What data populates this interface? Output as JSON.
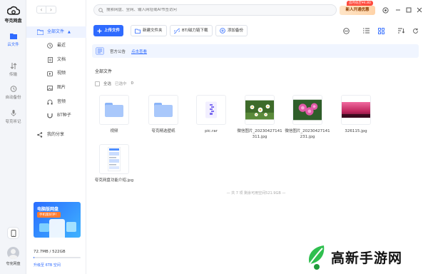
{
  "app": {
    "name": "夸克网盘"
  },
  "rail": {
    "items": [
      {
        "label": "云文件"
      },
      {
        "label": "传输"
      },
      {
        "label": "自动备份"
      },
      {
        "label": "夸克听记"
      }
    ],
    "user_label": "夸克网盘"
  },
  "tree": {
    "all_files": "全部文件",
    "recent": "最近",
    "docs": "文档",
    "video": "视频",
    "image": "图片",
    "audio": "音频",
    "bt": "BT种子",
    "share": "我的分享"
  },
  "promo": {
    "title": "电脑版网盘",
    "tag": "手机版好评！"
  },
  "storage": {
    "text": "72.7MB / 522GB",
    "used_fraction": 0.01,
    "upgrade": "升级至 6TB 空间"
  },
  "search": {
    "placeholder": "搜索网盘、全网、输入网址或AI书签访问"
  },
  "vip": {
    "label": "新人开通优惠",
    "tag": "首月低至¥4.80"
  },
  "toolbar": {
    "upload": "上传文件",
    "new_folder": "新建文件夹",
    "bt_download": "BT/磁力链下载",
    "add_backup": "添加备份"
  },
  "notice": {
    "label": "官方公告",
    "link": "点击查看"
  },
  "crumb": "全部文件",
  "selectall": {
    "label": "全选",
    "selected": "已选中",
    "count": "0"
  },
  "files": [
    {
      "name": "视频",
      "type": "folder"
    },
    {
      "name": "夸克精选壁纸",
      "type": "folder"
    },
    {
      "name": "pic.rar",
      "type": "archive"
    },
    {
      "name": "微信图片_20230427141311.jpg",
      "type": "image-daisy"
    },
    {
      "name": "微信图片_20230427141231.jpg",
      "type": "image-pink"
    },
    {
      "name": "326115.jpg",
      "type": "image-sunset"
    },
    {
      "name": "夸克网盘功能介绍.jpg",
      "type": "image-doc"
    }
  ],
  "footer": "— 共 7 项  剩余可用空间521.9GB —",
  "watermark": "高新手游网",
  "colors": {
    "accent": "#2f6bff",
    "vip": "#ffd3a8"
  }
}
